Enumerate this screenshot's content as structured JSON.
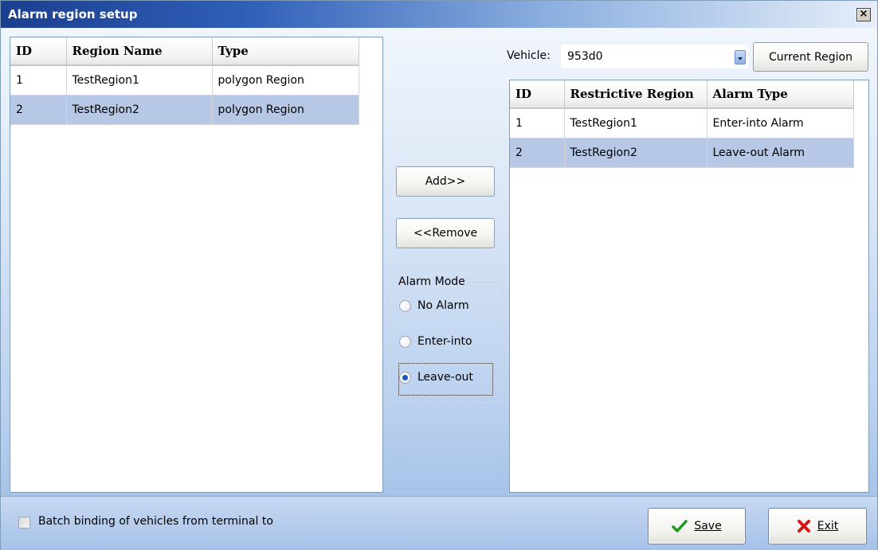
{
  "window": {
    "title": "Alarm region setup",
    "close_label": "×"
  },
  "left_grid": {
    "columns": [
      "ID",
      "Region Name",
      "Type"
    ],
    "rows": [
      {
        "id": "1",
        "name": "TestRegion1",
        "type": "polygon Region",
        "selected": false
      },
      {
        "id": "2",
        "name": "TestRegion2",
        "type": "polygon Region",
        "selected": true
      }
    ]
  },
  "vehicle": {
    "label": "Vehicle:",
    "value": "953d0"
  },
  "buttons": {
    "current_region": "Current Region",
    "add": "Add>>",
    "remove": "<<Remove",
    "save": "Save",
    "exit": "Exit"
  },
  "right_grid": {
    "columns": [
      "ID",
      "Restrictive Region",
      "Alarm Type"
    ],
    "rows": [
      {
        "id": "1",
        "region": "TestRegion1",
        "alarm_type": "Enter-into Alarm",
        "selected": false
      },
      {
        "id": "2",
        "region": "TestRegion2",
        "alarm_type": "Leave-out Alarm",
        "selected": true
      }
    ]
  },
  "alarm_mode": {
    "label": "Alarm Mode",
    "options": [
      {
        "label": "No Alarm",
        "checked": false
      },
      {
        "label": "Enter-into",
        "checked": false
      },
      {
        "label": "Leave-out",
        "checked": true
      }
    ]
  },
  "batch_binding": {
    "label": "Batch binding of vehicles from terminal to",
    "checked": false
  },
  "icons": {
    "save": "check-icon",
    "exit": "x-icon",
    "combo": "chevron-down-icon"
  },
  "colors": {
    "selected_row": "#b6c8e6",
    "title_bar": "#2f5fb8",
    "check_green": "#1d9a1d",
    "exit_red": "#d41818"
  }
}
